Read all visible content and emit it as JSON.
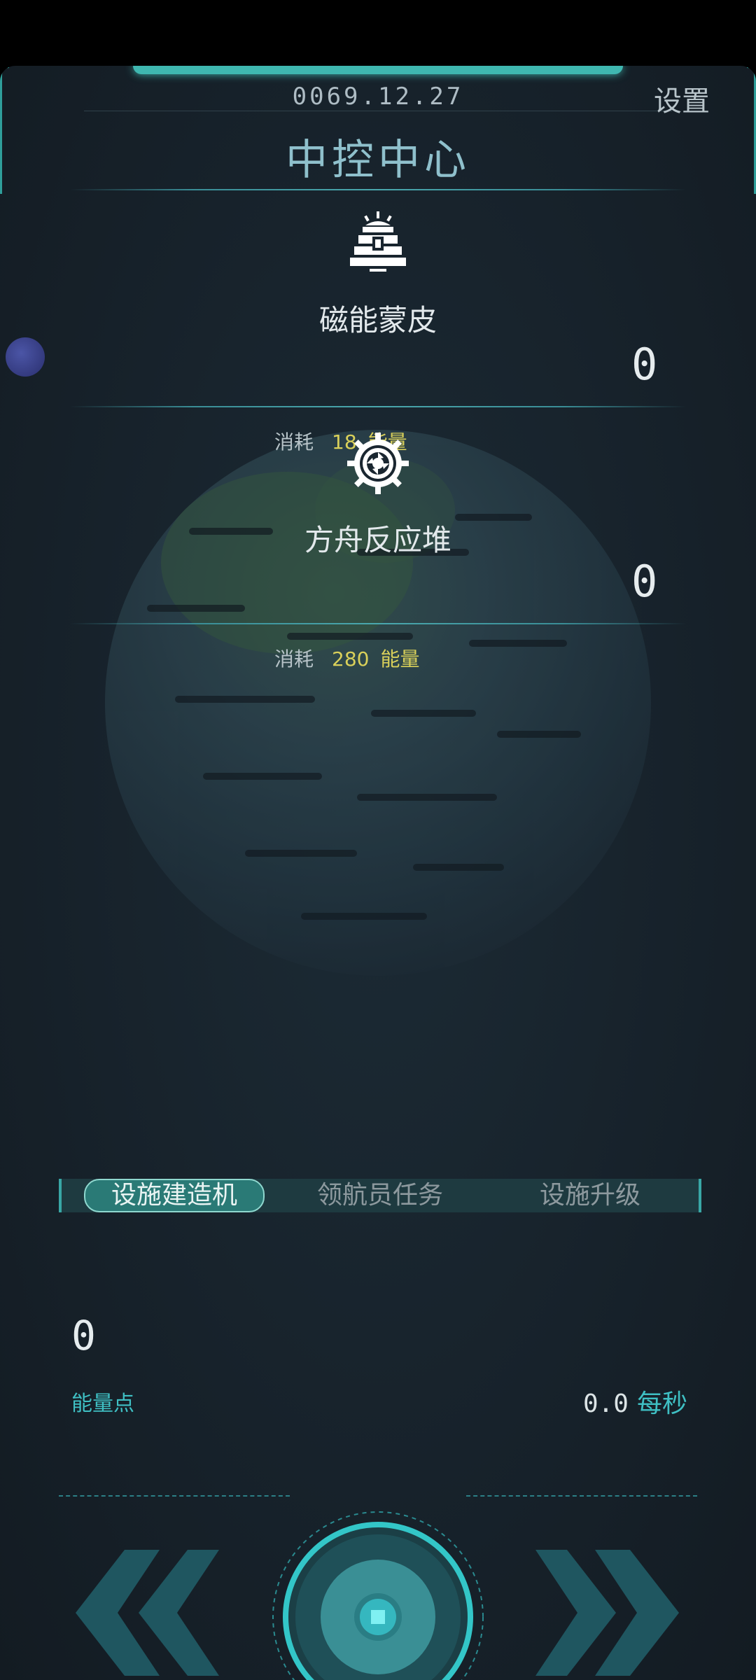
{
  "header": {
    "date": "0069.12.27",
    "settings_label": "设置",
    "title": "中控中心"
  },
  "facilities": [
    {
      "name": "磁能蒙皮",
      "icon": "solar-panel-icon",
      "cost_label": "消耗",
      "cost_value": "18",
      "cost_unit": "能量",
      "count": "0"
    },
    {
      "name": "方舟反应堆",
      "icon": "gear-reactor-icon",
      "cost_label": "消耗",
      "cost_value": "280",
      "cost_unit": "能量",
      "count": "0"
    }
  ],
  "tabs": [
    {
      "label": "设施建造机",
      "active": true
    },
    {
      "label": "领航员任务",
      "active": false
    },
    {
      "label": "设施升级",
      "active": false
    }
  ],
  "energy": {
    "value": "0",
    "label": "能量点",
    "rate_value": "0.0",
    "rate_unit": "每秒"
  },
  "colors": {
    "accent": "#3fc0c4",
    "cost": "#d9d05a",
    "title": "#8fc0cc"
  }
}
